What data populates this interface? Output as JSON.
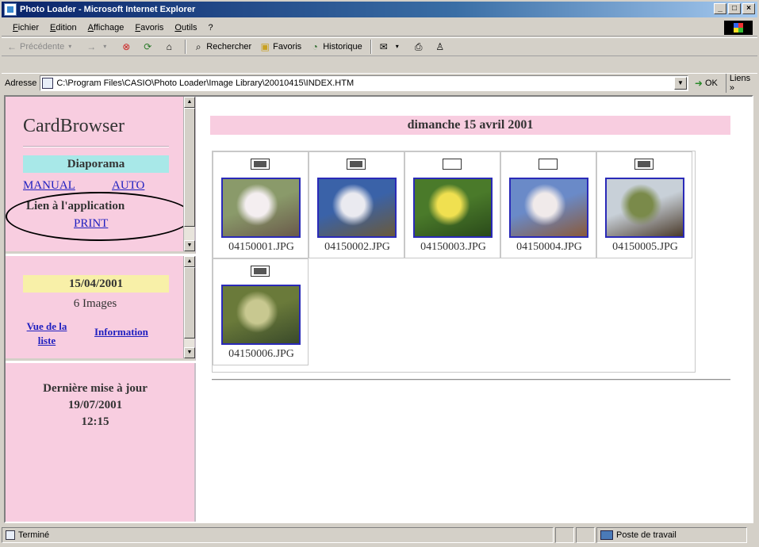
{
  "window": {
    "title": "Photo Loader - Microsoft Internet Explorer",
    "min": "_",
    "max": "□",
    "close": "×"
  },
  "menu": [
    "Fichier",
    "Edition",
    "Affichage",
    "Favoris",
    "Outils",
    "?"
  ],
  "toolbar": {
    "back": "Précédente",
    "search": "Rechercher",
    "favorites": "Favoris",
    "history": "Historique"
  },
  "address": {
    "label": "Adresse",
    "value": "C:\\Program Files\\CASIO\\Photo Loader\\Image Library\\20010415\\INDEX.HTM",
    "go": "OK",
    "links": "Liens »"
  },
  "left": {
    "title": "CardBrowser",
    "diaporama": "Diaporama",
    "manual": "MANUAL",
    "auto": "AUTO",
    "lien_app": "Lien à l'application",
    "print": "PRINT",
    "date": "15/04/2001",
    "count": "6 Images",
    "vue_line1": "Vue de la",
    "vue_line2": "liste",
    "information": "Information",
    "maj_line1": "Dernière mise à jour",
    "maj_line2": "19/07/2001",
    "maj_line3": "12:15"
  },
  "main": {
    "date_header": "dimanche 15 avril 2001",
    "photos": [
      {
        "name": "04150001.JPG",
        "printed": true,
        "colors": [
          "#8a9a6a",
          "#f4eef0",
          "#6a5a4a"
        ]
      },
      {
        "name": "04150002.JPG",
        "printed": true,
        "colors": [
          "#3a62a8",
          "#eaeaf0",
          "#6a5a3a"
        ]
      },
      {
        "name": "04150003.JPG",
        "printed": false,
        "colors": [
          "#4a7a2a",
          "#f0e050",
          "#2a4a1a"
        ]
      },
      {
        "name": "04150004.JPG",
        "printed": false,
        "colors": [
          "#6a8ac8",
          "#f0eaea",
          "#8a5a3a"
        ]
      },
      {
        "name": "04150005.JPG",
        "printed": true,
        "colors": [
          "#c8d0d8",
          "#7a8a4a",
          "#4a3a2a"
        ]
      },
      {
        "name": "04150006.JPG",
        "printed": true,
        "colors": [
          "#6a7a3a",
          "#c8c890",
          "#3a4a2a"
        ]
      }
    ]
  },
  "status": {
    "text": "Terminé",
    "zone": "Poste de travail"
  }
}
